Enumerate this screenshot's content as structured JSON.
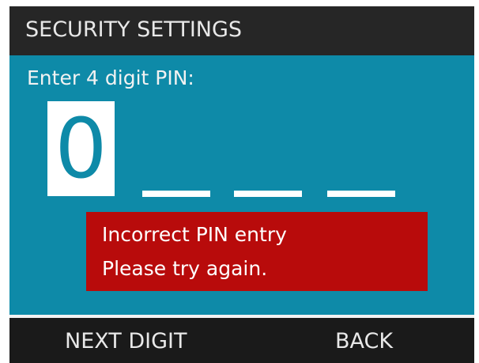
{
  "header": {
    "title": "SECURITY SETTINGS"
  },
  "pin_entry": {
    "prompt": "Enter 4 digit PIN:",
    "current_digit": "0",
    "digits_total": 4
  },
  "error": {
    "line1": "Incorrect PIN entry",
    "line2": "Please try again."
  },
  "softkeys": {
    "left": "NEXT DIGIT",
    "right": "BACK"
  },
  "colors": {
    "header_bg": "#262626",
    "body_bg": "#0e8aa8",
    "error_bg": "#b80b0b",
    "text": "#ffffff"
  }
}
